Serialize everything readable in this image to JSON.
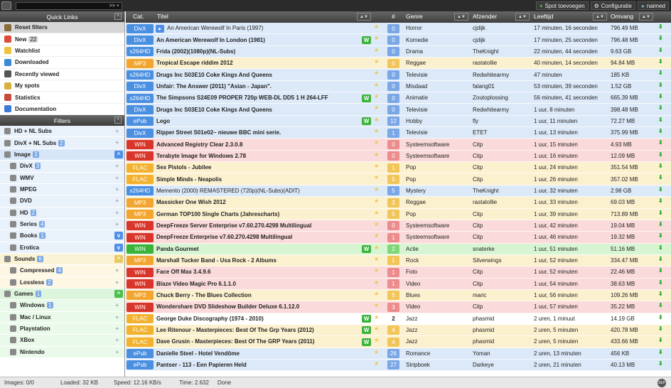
{
  "topbar": {
    "search_label": ">> +",
    "spot_btn": "Spot toevoegen",
    "config_btn": "Configuratie",
    "user_btn": "naimed"
  },
  "quicklinks": {
    "header": "Quick Links",
    "items": [
      {
        "label": "Reset filters",
        "count": "",
        "icon": "home-icon",
        "color": "#8a6b3a",
        "selected": true
      },
      {
        "label": "New",
        "count": "22",
        "icon": "new-icon",
        "color": "#e04a3a",
        "selected": false
      },
      {
        "label": "Watchlist",
        "count": "",
        "icon": "star-icon",
        "color": "#f0c040",
        "selected": false
      },
      {
        "label": "Downloaded",
        "count": "",
        "icon": "download-icon",
        "color": "#3a8ad8",
        "selected": false
      },
      {
        "label": "Recently viewed",
        "count": "",
        "icon": "eye-icon",
        "color": "#555",
        "selected": false
      },
      {
        "label": "My spots",
        "count": "",
        "icon": "user-icon",
        "color": "#d8b040",
        "selected": false
      },
      {
        "label": "Statistics",
        "count": "",
        "icon": "chart-icon",
        "color": "#c84a3a",
        "selected": false
      },
      {
        "label": "Documentation",
        "count": "",
        "icon": "help-icon",
        "color": "#3a7ad8",
        "selected": false
      }
    ]
  },
  "filters": {
    "header": "Filters",
    "items": [
      {
        "label": "HD + NL Subs",
        "count": "",
        "indent": 0,
        "bg": "#e9f1fb",
        "toggle": ""
      },
      {
        "label": "DivX + NL Subs",
        "count": "2",
        "indent": 0,
        "bg": "#e9f1fb",
        "toggle": ""
      },
      {
        "label": "Image",
        "count": "3",
        "indent": 0,
        "bg": "#d7e6f8",
        "toggle": "^"
      },
      {
        "label": "DivX",
        "count": "3",
        "indent": 1,
        "bg": "#e9f1fb",
        "toggle": ""
      },
      {
        "label": "WMV",
        "count": "",
        "indent": 1,
        "bg": "#e9f1fb",
        "toggle": ""
      },
      {
        "label": "MPEG",
        "count": "",
        "indent": 1,
        "bg": "#e9f1fb",
        "toggle": ""
      },
      {
        "label": "DVD",
        "count": "",
        "indent": 1,
        "bg": "#e9f1fb",
        "toggle": ""
      },
      {
        "label": "HD",
        "count": "2",
        "indent": 1,
        "bg": "#e9f1fb",
        "toggle": ""
      },
      {
        "label": "Series",
        "count": "4",
        "indent": 1,
        "bg": "#e9f1fb",
        "toggle": ""
      },
      {
        "label": "Books",
        "count": "1",
        "indent": 1,
        "bg": "#e9f1fb",
        "toggle": "v"
      },
      {
        "label": "Erotica",
        "count": "",
        "indent": 1,
        "bg": "#e9f1fb",
        "toggle": "v"
      },
      {
        "label": "Sounds",
        "count": "6",
        "indent": 0,
        "bg": "#fbf3d6",
        "toggle": "^"
      },
      {
        "label": "Compressed",
        "count": "4",
        "indent": 1,
        "bg": "#fdf7e4",
        "toggle": ""
      },
      {
        "label": "Lossless",
        "count": "2",
        "indent": 1,
        "bg": "#fdf7e4",
        "toggle": ""
      },
      {
        "label": "Games",
        "count": "1",
        "indent": 0,
        "bg": "#dcf5dc",
        "toggle": "^"
      },
      {
        "label": "Windows",
        "count": "1",
        "indent": 1,
        "bg": "#eafaea",
        "toggle": ""
      },
      {
        "label": "Mac / Linux",
        "count": "",
        "indent": 1,
        "bg": "#eafaea",
        "toggle": ""
      },
      {
        "label": "Playstation",
        "count": "",
        "indent": 1,
        "bg": "#eafaea",
        "toggle": ""
      },
      {
        "label": "XBox",
        "count": "",
        "indent": 1,
        "bg": "#eafaea",
        "toggle": ""
      },
      {
        "label": "Nintendo",
        "count": "",
        "indent": 1,
        "bg": "#eafaea",
        "toggle": ""
      }
    ]
  },
  "table": {
    "headers": {
      "cat": "Cat.",
      "titel": "Titel",
      "hash": "#",
      "genre": "Genre",
      "afzender": "Afzender",
      "leeftijd": "Leeftijd",
      "omvang": "Omvang"
    },
    "rows": [
      {
        "cat": "DivX",
        "title": "An American Werewolf In Paris (1997)",
        "w": false,
        "num": "0",
        "genre": "Horror",
        "afz": "cjdijk",
        "age": "17 minuten, 16 seconden",
        "size": "796.49 MB",
        "tone": "blue",
        "bold": false,
        "icon": true
      },
      {
        "cat": "DivX",
        "title": "An American Werewolf In London (1981)",
        "w": true,
        "num": "0",
        "genre": "Komedie",
        "afz": "cjdijk",
        "age": "17 minuten, 25 seconden",
        "size": "796.48 MB",
        "tone": "blue",
        "bold": true,
        "icon": false
      },
      {
        "cat": "x264HD",
        "title": "Frida (2002)(1080p)(NL-Subs)",
        "w": false,
        "num": "0",
        "genre": "Drama",
        "afz": "TheKnight",
        "age": "22 minuten, 44 seconden",
        "size": "9.63 GB",
        "tone": "blue",
        "bold": true,
        "icon": false
      },
      {
        "cat": "MP3",
        "title": "Tropical Escape riddim 2012",
        "w": false,
        "num": "0",
        "genre": "Reggae",
        "afz": "rastatollie",
        "age": "40 minuten, 14 seconden",
        "size": "94.84 MB",
        "tone": "yellow",
        "bold": true,
        "icon": false
      },
      {
        "cat": "x264HD",
        "title": "Drugs Inc S03E10 Coke Kings And Queens",
        "w": false,
        "num": "0",
        "genre": "Televisie",
        "afz": "Redwhitearmy",
        "age": "47 minuten",
        "size": "185 KB",
        "tone": "blue",
        "bold": true,
        "icon": false
      },
      {
        "cat": "DivX",
        "title": "Unfair: The Answer (2011) \"Asian - Japan\".",
        "w": false,
        "num": "0",
        "genre": "Misdaad",
        "afz": "falang01",
        "age": "53 minuten, 39 seconden",
        "size": "1.52 GB",
        "tone": "blue",
        "bold": true,
        "icon": false
      },
      {
        "cat": "x264HD",
        "title": "The Simpsons S24E09 PROPER 720p WEB-DL DD5 1 H 264-LFF",
        "w": true,
        "num": "0",
        "genre": "Animatie",
        "afz": "Zoutoplossing",
        "age": "56 minuten, 41 seconden",
        "size": "665.39 MB",
        "tone": "blue",
        "bold": true,
        "icon": false
      },
      {
        "cat": "DivX",
        "title": "Drugs Inc S03E10 Coke Kings And Queens",
        "w": false,
        "num": "0",
        "genre": "Televisie",
        "afz": "Redwhitearmy",
        "age": "1 uur, 8 minuten",
        "size": "398.48 MB",
        "tone": "blue",
        "bold": true,
        "icon": false
      },
      {
        "cat": "ePub",
        "title": "Lego",
        "w": true,
        "num": "12",
        "genre": "Hobby",
        "afz": "fly",
        "age": "1 uur, 11 minuten",
        "size": "72.27 MB",
        "tone": "blue",
        "bold": true,
        "icon": false
      },
      {
        "cat": "DivX",
        "title": "Ripper Street S01e02– nieuwe BBC mini serie.",
        "w": false,
        "num": "1",
        "genre": "Televisie",
        "afz": "ETET",
        "age": "1 uur, 13 minuten",
        "size": "375.99 MB",
        "tone": "blue",
        "bold": true,
        "icon": false
      },
      {
        "cat": "WIN",
        "title": "Advanced Registry Clear 2.3.0.8",
        "w": false,
        "num": "0",
        "genre": "Systeemsoftware",
        "afz": "Citp",
        "age": "1 uur, 15 minuten",
        "size": "4.93 MB",
        "tone": "red",
        "bold": true,
        "icon": false
      },
      {
        "cat": "WIN",
        "title": "Terabyte Image for Windows 2.78",
        "w": false,
        "num": "0",
        "genre": "Systeemsoftware",
        "afz": "Citp",
        "age": "1 uur, 16 minuten",
        "size": "12.09 MB",
        "tone": "red",
        "bold": true,
        "icon": false
      },
      {
        "cat": "FLAC",
        "title": "Sex Pistols - Jubilee",
        "w": false,
        "num": "1",
        "genre": "Pop",
        "afz": "Citp",
        "age": "1 uur, 24 minuten",
        "size": "351.54 MB",
        "tone": "yellow",
        "bold": true,
        "icon": false
      },
      {
        "cat": "FLAC",
        "title": "Simple Minds - Neapolis",
        "w": false,
        "num": "5",
        "genre": "Pop",
        "afz": "Citp",
        "age": "1 uur, 26 minuten",
        "size": "357.02 MB",
        "tone": "yellow",
        "bold": true,
        "icon": false
      },
      {
        "cat": "x264HD",
        "title": "Memento (2000) REMASTERED (720p)(NL-Subs)(ADIT)",
        "w": false,
        "num": "5",
        "genre": "Mystery",
        "afz": "TheKnight",
        "age": "1 uur, 32 minuten",
        "size": "2.98 GB",
        "tone": "blue",
        "bold": false,
        "icon": false
      },
      {
        "cat": "MP3",
        "title": "Massicker One Wish 2012",
        "w": false,
        "num": "3",
        "genre": "Reggae",
        "afz": "rastatollie",
        "age": "1 uur, 33 minuten",
        "size": "69.03 MB",
        "tone": "yellow",
        "bold": true,
        "icon": false
      },
      {
        "cat": "MP3",
        "title": "German TOP100 Single Charts (Jahrescharts)",
        "w": false,
        "num": "5",
        "genre": "Pop",
        "afz": "Citp",
        "age": "1 uur, 39 minuten",
        "size": "713.89 MB",
        "tone": "yellow",
        "bold": true,
        "icon": false
      },
      {
        "cat": "WIN",
        "title": "DeepFreeze Server Enterprise v7.60.270.4298 Multilingual",
        "w": false,
        "num": "0",
        "genre": "Systeemsoftware",
        "afz": "Citp",
        "age": "1 uur, 42 minuten",
        "size": "19.04 MB",
        "tone": "red",
        "bold": true,
        "icon": false
      },
      {
        "cat": "WIN",
        "title": "DeepFreeze Enterprise v7.60.270.4298 Multilingual",
        "w": false,
        "num": "1",
        "genre": "Systeemsoftware",
        "afz": "Citp",
        "age": "1 uur, 46 minuten",
        "size": "19.32 MB",
        "tone": "red",
        "bold": true,
        "icon": false
      },
      {
        "cat": "WIN",
        "title": "Panda Gourmet",
        "w": true,
        "num": "2",
        "genre": "Actie",
        "afz": "snaterke",
        "age": "1 uur, 51 minuten",
        "size": "51.16 MB",
        "tone": "green",
        "bold": true,
        "icon": false
      },
      {
        "cat": "MP3",
        "title": "Marshall Tucker Band - Usa Rock - 2 Albums",
        "w": false,
        "num": "1",
        "genre": "Rock",
        "afz": "Silverwings",
        "age": "1 uur, 52 minuten",
        "size": "334.47 MB",
        "tone": "yellow",
        "bold": true,
        "icon": false
      },
      {
        "cat": "WIN",
        "title": "Face Off Max 3.4.9.6",
        "w": false,
        "num": "1",
        "genre": "Foto",
        "afz": "Citp",
        "age": "1 uur, 52 minuten",
        "size": "22.46 MB",
        "tone": "red",
        "bold": true,
        "icon": false
      },
      {
        "cat": "WIN",
        "title": "Blaze Video Magic Pro 6.1.1.0",
        "w": false,
        "num": "1",
        "genre": "Video",
        "afz": "Citp",
        "age": "1 uur, 54 minuten",
        "size": "38.63 MB",
        "tone": "red",
        "bold": true,
        "icon": false
      },
      {
        "cat": "MP3",
        "title": "Chuck Berry - The Blues Collection",
        "w": false,
        "num": "5",
        "genre": "Blues",
        "afz": "maric",
        "age": "1 uur, 56 minuten",
        "size": "109.26 MB",
        "tone": "yellow",
        "bold": true,
        "icon": false
      },
      {
        "cat": "WIN",
        "title": "Wondershare DVD Slideshow Builder Deluxe 6.1.12.0",
        "w": false,
        "num": "3",
        "genre": "Video",
        "afz": "Citp",
        "age": "1 uur, 57 minuten",
        "size": "35.22 MB",
        "tone": "red",
        "bold": true,
        "icon": false
      },
      {
        "cat": "FLAC",
        "title": "George Duke Discography (1974 - 2010)",
        "w": true,
        "num": "2",
        "genre": "Jazz",
        "afz": "phasmid",
        "age": "2 uren, 1 minuut",
        "size": "14.19 GB",
        "tone": "white",
        "bold": true,
        "icon": false
      },
      {
        "cat": "FLAC",
        "title": "Lee Ritenour - Masterpieces: Best Of The Grp Years (2012)",
        "w": true,
        "num": "4",
        "genre": "Jazz",
        "afz": "phasmid",
        "age": "2 uren, 5 minuten",
        "size": "420.78 MB",
        "tone": "yellow",
        "bold": true,
        "icon": false
      },
      {
        "cat": "FLAC",
        "title": "Dave Grusin - Masterpieces: Best Of The GRP Years (2011)",
        "w": true,
        "num": "4",
        "genre": "Jazz",
        "afz": "phasmid",
        "age": "2 uren, 5 minuten",
        "size": "433.66 MB",
        "tone": "yellow",
        "bold": true,
        "icon": false
      },
      {
        "cat": "ePub",
        "title": "Danielle Steel - Hotel Vendôme",
        "w": false,
        "num": "26",
        "genre": "Romance",
        "afz": "Yoman",
        "age": "2 uren, 13 minuten",
        "size": "456 KB",
        "tone": "blue",
        "bold": true,
        "icon": false
      },
      {
        "cat": "ePub",
        "title": "Pantser - 113 - Een Papieren Held",
        "w": false,
        "num": "27",
        "genre": "Stripboek",
        "afz": "Darkeye",
        "age": "2 uren, 21 minuten",
        "size": "40.13 MB",
        "tone": "blue",
        "bold": true,
        "icon": false
      }
    ]
  },
  "status": {
    "images": "Images: 0/0",
    "loaded": "Loaded: 32 KB",
    "speed": "Speed: 12.16 KB/s",
    "time": "Time: 2.632",
    "done": "Done"
  },
  "colors": {
    "cat_divx": "#4a8fe0",
    "cat_mp3": "#f2a530",
    "cat_win": "#d8362a",
    "cat_flac": "#f2b230",
    "cat_green": "#3ab33a"
  }
}
